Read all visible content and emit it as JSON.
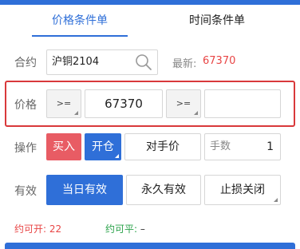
{
  "tabs": {
    "price_condition": "价格条件单",
    "time_condition": "时间条件单"
  },
  "contract": {
    "label": "合约",
    "value": "沪铜2104",
    "latest_label": "最新:",
    "latest_value": "67370"
  },
  "price": {
    "label": "价格",
    "operator1": ">=",
    "value1": "67370",
    "operator2": ">=",
    "value2": ""
  },
  "operation": {
    "label": "操作",
    "direction": "买入",
    "offset": "开仓",
    "price_type": "对手价",
    "qty_label": "手数",
    "qty_value": "1"
  },
  "validity": {
    "label": "有效",
    "today": "当日有效",
    "permanent": "永久有效",
    "stop_loss": "止损关闭"
  },
  "availability": {
    "open_label": "约可开:",
    "open_value": "22",
    "close_label": "约可平:",
    "close_value": "–"
  },
  "colors": {
    "accent_blue": "#2f6fd8",
    "buy_red": "#e85c64",
    "highlight_frame": "#d9393b",
    "price_red": "#e84545",
    "close_green": "#2aa24a"
  }
}
